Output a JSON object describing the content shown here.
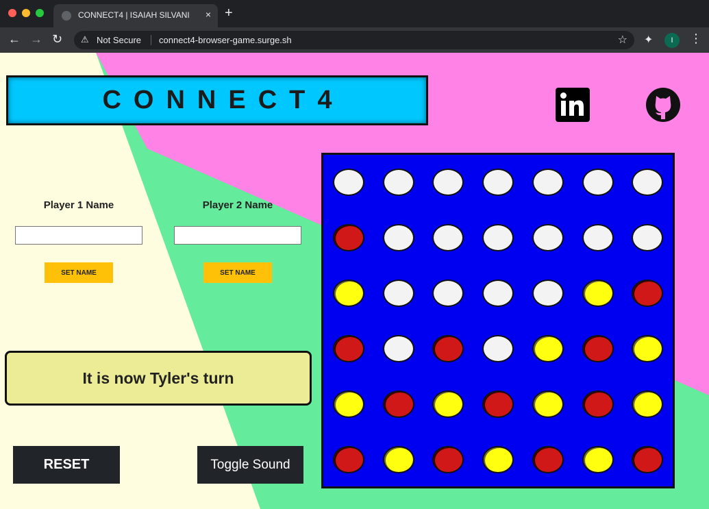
{
  "browser": {
    "tab_title": "CONNECT4 | ISAIAH SILVANI",
    "tab_close": "×",
    "new_tab": "+",
    "security_label": "Not Secure",
    "url": "connect4-browser-game.surge.sh",
    "profile_initial": "I"
  },
  "colors": {
    "cream": "#fffddf",
    "green": "#64eb9c",
    "pink": "#ff82e6",
    "title_cyan": "#00c8ff",
    "board_blue": "#0000f0",
    "red_piece": "#d01818",
    "yellow_piece": "#ffff10",
    "button_yellow": "#ffc107",
    "turn_bg": "#ecec96"
  },
  "page": {
    "title": "CONNECT4",
    "social": {
      "linkedin_icon": "linkedin-icon",
      "github_icon": "github-icon"
    },
    "player1": {
      "label": "Player 1 Name",
      "value": "",
      "button": "SET NAME"
    },
    "player2": {
      "label": "Player 2 Name",
      "value": "",
      "button": "SET NAME"
    },
    "turn_message": "It is now Tyler's turn",
    "reset_label": "RESET",
    "sound_label": "Toggle Sound"
  },
  "board": {
    "rows": 6,
    "cols": 7,
    "cells": [
      [
        "empty",
        "empty",
        "empty",
        "empty",
        "empty",
        "empty",
        "empty"
      ],
      [
        "red",
        "empty",
        "empty",
        "empty",
        "empty",
        "empty",
        "empty"
      ],
      [
        "yellow",
        "empty",
        "empty",
        "empty",
        "empty",
        "yellow",
        "red"
      ],
      [
        "red",
        "empty",
        "red",
        "empty",
        "yellow",
        "red",
        "yellow"
      ],
      [
        "yellow",
        "red",
        "yellow",
        "red",
        "yellow",
        "red",
        "yellow"
      ],
      [
        "red",
        "yellow",
        "red",
        "yellow",
        "red",
        "yellow",
        "red"
      ]
    ]
  }
}
